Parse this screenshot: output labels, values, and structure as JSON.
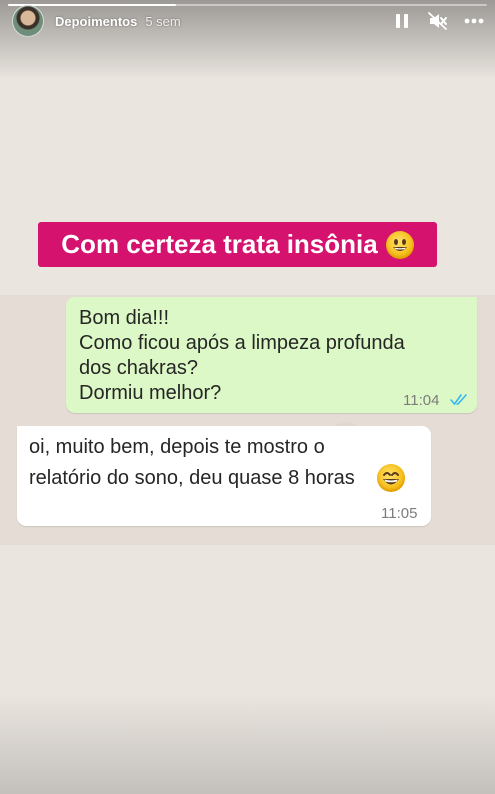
{
  "story": {
    "account_name": "Depoimentos",
    "time_ago": "5 sem",
    "progress": 0.35
  },
  "icons": {
    "pause": "pause-icon",
    "mute": "speaker-muted-icon",
    "more": "more-horizontal-icon",
    "caption_emoji": "grinning-face-emoji",
    "reply_emoji": "grinning-face-smiling-eyes-emoji",
    "read_receipt": "double-check-icon"
  },
  "caption": {
    "text": "Com certeza trata insônia"
  },
  "chat": {
    "outgoing": {
      "lines": [
        "Bom dia!!!",
        "Como ficou após a limpeza profunda",
        "dos chakras?",
        "Dormiu melhor?"
      ],
      "time": "11:04"
    },
    "incoming": {
      "lines": [
        "oi, muito bem, depois te mostro o",
        "relatório do sono, deu quase 8 horas"
      ],
      "time": "11:05"
    }
  },
  "colors": {
    "caption_bg": "#d5136e",
    "outgoing_bubble": "#dcf8c6",
    "incoming_bubble": "#ffffff",
    "read_tick": "#34b7f1"
  }
}
